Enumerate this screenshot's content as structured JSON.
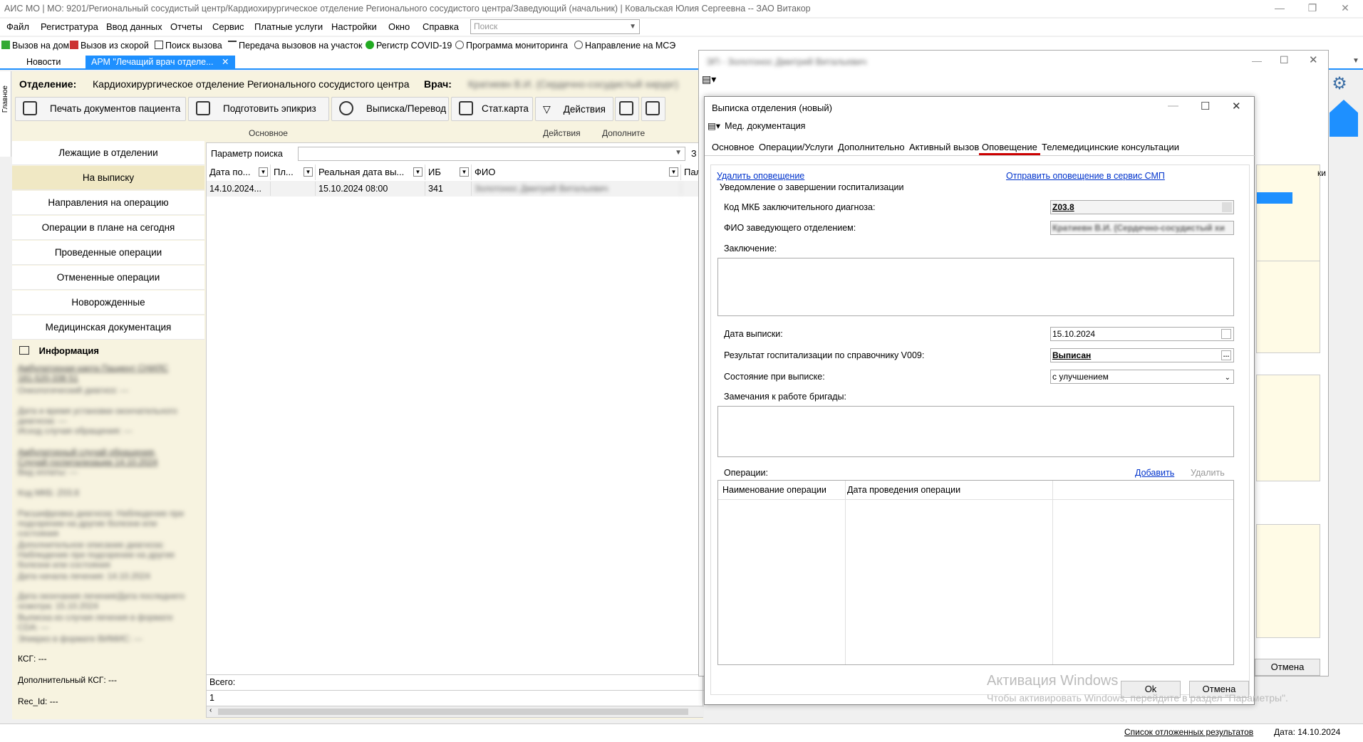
{
  "window": {
    "title": "АИС МО | МО: 9201/Региональный сосудистый центр/Кардиохирургическое отделение Регионального сосудистого центра/Заведующий (начальник) | Ковальская Юлия Сергеевна -- ЗАО Витакор"
  },
  "menu": {
    "items": [
      "Файл",
      "Регистратура",
      "Ввод данных",
      "Отчеты",
      "Сервис",
      "Платные услуги",
      "Настройки",
      "Окно",
      "Справка"
    ],
    "search_placeholder": "Поиск"
  },
  "quickbar": {
    "items": [
      "Вызов на дом",
      "Вызов из скорой",
      "Поиск вызова",
      "Передача вызовов на участок",
      "Регистр COVID-19",
      "Программа мониторинга",
      "Направление на МСЭ"
    ]
  },
  "doctabs": {
    "news": "Новости",
    "active": "АРМ \"Лечащий врач отделе...",
    "close": "✕"
  },
  "leftstrip_label": "Главное",
  "header": {
    "otd_label": "Отделение:",
    "otd_value": "Кардиохирургическое отделение Регионального сосудистого центра",
    "doctor_label": "Врач:",
    "doctor_value": "Кратиевн В.И. (Сердечно-сосудистый хирург)"
  },
  "toolbar": {
    "print": "Печать документов пациента",
    "epicrisis": "Подготовить эпикриз",
    "discharge": "Выписка/Перевод",
    "statcard": "Стат.карта",
    "actions": "Действия",
    "group_main": "Основное",
    "group_actions": "Действия",
    "group_extra": "Дополните"
  },
  "nav": {
    "items": [
      "Лежащие в отделении",
      "На выписку",
      "Направления на операцию",
      "Операции в плане на сегодня",
      "Проведенные операции",
      "Отмененные операции",
      "Новорожденные",
      "Медицинская документация"
    ]
  },
  "info": {
    "title": "Информация",
    "blurred": [
      "Амбулаторная карта Пациент СНИЛС",
      "181-520-338 51",
      "Онкологический диагноз: ---",
      "Дата и время установки окончательного",
      "диагноза: ---",
      "Исход случая обращения: ---",
      "Амбулаторный случай обращения,",
      "Случай госпитализации 14.10.2024",
      "Вид оплаты: ---",
      "Код МКБ: Z03.8",
      "Расшифровка диагноза: Наблюдение при",
      "подозрении на другие болезни или",
      "состояния",
      "Дополнительное описание диагноза:",
      "Наблюдение при подозрении на другие",
      "болезни или состояния",
      "Дата начала лечения: 14.10.2024",
      "Дата окончания лечения/Дата последнего",
      "осмотра: 15.10.2024",
      "Выписка из случая лечения в формате",
      "CDA: ---",
      "Эпикриз в формате ВИМИС: ---"
    ],
    "ksg": "КСГ: ---",
    "extra_ksg": "Дополнительный КСГ: ---",
    "rec_id": "Rec_Id: ---"
  },
  "grid": {
    "search_param": "Параметр поиска",
    "headers": [
      "Дата по...",
      "Пл...",
      "Реальная дата вы...",
      "ИБ",
      "ФИО",
      "Пал"
    ],
    "row": {
      "date": "14.10.2024...",
      "pl": "",
      "real_date": "15.10.2024 08:00",
      "ib": "341",
      "fio": "Золотонос Дмитрий Витальевич"
    },
    "total_label": "Всего:",
    "total_value": "1",
    "extra_col": "З"
  },
  "bgdialog": {
    "title": "ЭП - Золотонос Дмитрий Витальевич",
    "right_col": "ки",
    "cancel": "Отмена"
  },
  "dialog": {
    "title": "Выписка отделения (новый)",
    "toolbar_doc": "Мед. документация",
    "tabs": [
      "Основное",
      "Операции/Услуги",
      "Дополнительно",
      "Активный вызов",
      "Оповещение",
      "Телемедицинские консультации"
    ],
    "delete_link": "Удалить оповещение",
    "send_link": "Отправить оповещение в сервис СМП",
    "fieldset": "Уведомление о завершении госпитализации",
    "mkb_label": "Код МКБ заключительного диагноза:",
    "mkb_value": "Z03.8",
    "head_label": "ФИО заведующего отделением:",
    "head_value": "Кратиевн В.И. (Сердечно-сосудистый хи",
    "conclusion_label": "Заключение:",
    "discharge_date_label": "Дата выписки:",
    "discharge_date_value": "15.10.2024",
    "result_label": "Результат госпитализации по справочнику V009:",
    "result_value": "Выписан",
    "state_label": "Состояние при выписке:",
    "state_value": "с улучшением",
    "remarks_label": "Замечания к работе бригады:",
    "ops_label": "Операции:",
    "ops_add": "Добавить",
    "ops_delete": "Удалить",
    "ops_col1": "Наименование операции",
    "ops_col2": "Дата проведения операции",
    "ok": "Ok",
    "cancel": "Отмена"
  },
  "watermark": {
    "line1": "Активация Windows",
    "line2": "Чтобы активировать Windows, перейдите в раздел \"Параметры\"."
  },
  "status": {
    "postponed": "Список отложенных результатов",
    "date": "Дата: 14.10.2024"
  },
  "colors": {
    "accent": "#1e90ff",
    "selected_nav": "#f0e8c4",
    "panel_bg": "#f7f3e0",
    "link": "#0033cc",
    "active_tab_underline": "#cc0000"
  }
}
